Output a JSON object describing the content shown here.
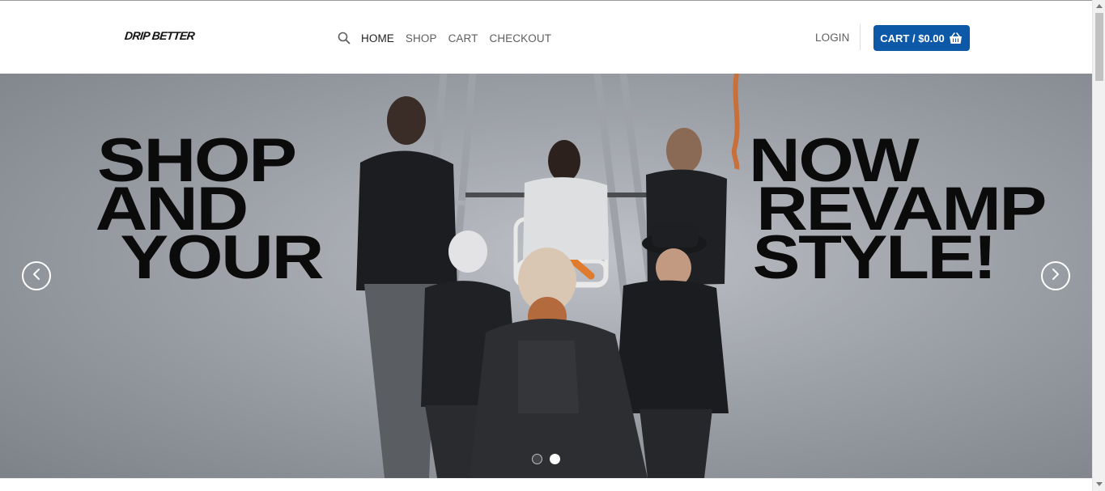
{
  "header": {
    "logo": "DRIP BETTER",
    "nav": [
      {
        "label": "HOME",
        "active": true
      },
      {
        "label": "SHOP",
        "active": false
      },
      {
        "label": "CART",
        "active": false
      },
      {
        "label": "CHECKOUT",
        "active": false
      }
    ],
    "login_label": "LOGIN",
    "cart_label": "CART / $0.00",
    "search_icon": "search-icon",
    "cart_icon": "basket-icon"
  },
  "hero": {
    "left_lines": [
      "SHOP",
      "AND",
      "YOUR"
    ],
    "right_lines": [
      "NOW",
      "REVAMP",
      "STYLE!"
    ],
    "prev_icon": "chevron-left-icon",
    "next_icon": "chevron-right-icon",
    "slides_total": 2,
    "active_slide": 2
  },
  "colors": {
    "cart_button": "#0d59a8",
    "nav_text": "#5e5e5e",
    "hero_text": "#0b0b0b",
    "accent_orange": "#e07a2c"
  }
}
